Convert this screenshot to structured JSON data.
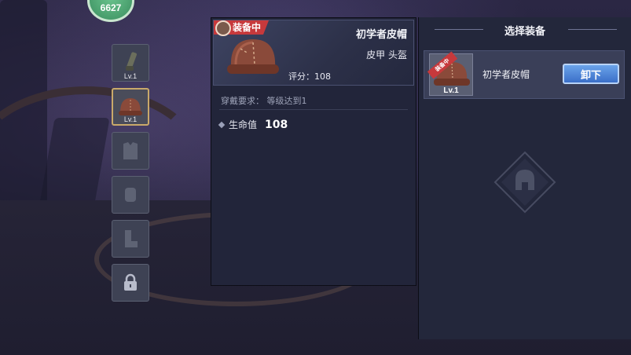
{
  "hud": {
    "coin_value": "6627"
  },
  "slots": [
    {
      "name": "weapon",
      "lv": "Lv.1",
      "icon": "cannon-icon",
      "selected": false
    },
    {
      "name": "helmet",
      "lv": "Lv.1",
      "icon": "leather-hat-icon",
      "selected": true
    },
    {
      "name": "armor",
      "lv": "",
      "icon": "armor-icon",
      "selected": false
    },
    {
      "name": "gloves",
      "lv": "",
      "icon": "gloves-icon",
      "selected": false
    },
    {
      "name": "boots",
      "lv": "",
      "icon": "boots-icon",
      "selected": false
    },
    {
      "name": "locked",
      "lv": "",
      "icon": "lock-icon",
      "selected": false
    }
  ],
  "detail": {
    "tag": "装备中",
    "name": "初学者皮帽",
    "type": "皮甲 头盔",
    "score": "评分：108",
    "requirement": "穿戴要求：  等级达到1",
    "stats": [
      {
        "label": "生命值",
        "value": "108"
      }
    ]
  },
  "select_panel": {
    "title": "选择装备",
    "items": [
      {
        "ribbon": "装备中",
        "lv": "Lv.1",
        "name": "初学者皮帽",
        "button": "卸下"
      }
    ]
  },
  "colors": {
    "accent_red": "#c7393c",
    "button_blue": "#3b6fc8",
    "panel": "#22253a"
  }
}
